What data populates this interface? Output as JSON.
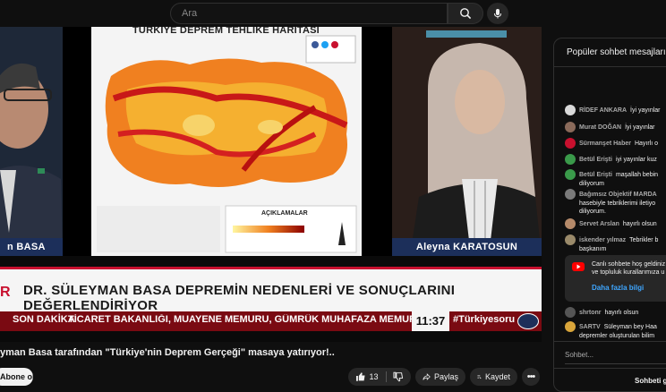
{
  "search": {
    "placeholder": "Ara"
  },
  "video": {
    "map_title": "TÜRKİYE DEPREM TEHLİKE HARİTASI",
    "legend_title": "AÇIKLAMALAR",
    "guest_name": "n BASA",
    "host_name": "Aleyna KARATOSUN",
    "headline": "DR. SÜLEYMAN BASA DEPREMİN NEDENLERİ VE SONUÇLARINI DEĞERLENDİRİYOR",
    "breaking_label": "SON DAKİKA",
    "ticker_text": "TİCARET BAKANLIĞI, MUAYENE MEMURU, GÜMRÜK MUHAFAZA MEMURU İLE KORUMA V",
    "clock": "11:37",
    "hashtag": "#Türkiyesoru"
  },
  "title": "yman Basa tarafından \"Türkiye'nin Deprem Gerçeği\" masaya yatırıyor!..",
  "actions": {
    "subscribe": "Abone ol",
    "likes": "13",
    "share": "Paylaş",
    "save": "Kaydet"
  },
  "chat": {
    "header": "Popüler sohbet mesajları",
    "messages": [
      {
        "author": "RİDEF ANKARA",
        "lines": [
          "İyi yayınlar"
        ],
        "avatar_color": "#d9d9d9"
      },
      {
        "author": "Murat DOĞAN",
        "lines": [
          "İyi yayınlar"
        ],
        "avatar_color": "#8a6a5a"
      },
      {
        "author": "Sürmanşet Haber",
        "lines": [
          "Hayırlı o"
        ],
        "avatar_color": "#c8102e"
      },
      {
        "author": "Betül Erişti",
        "lines": [
          "iyi yayınlar kuz"
        ],
        "avatar_color": "#3a9a4a"
      },
      {
        "author": "Betül Erişti",
        "lines": [
          "maşallah bebin",
          "diliyorum"
        ],
        "avatar_color": "#3a9a4a"
      },
      {
        "author": "Bağımsız Objektif MARDA",
        "lines": [
          "hasebiyle tebriklerimi iletiyo",
          "diliyorum."
        ],
        "avatar_color": "#7a7a7a"
      },
      {
        "author": "Servet Arslan",
        "lines": [
          "hayırlı olsun"
        ],
        "avatar_color": "#b58a6a"
      },
      {
        "author": "iskender yılmaz",
        "lines": [
          "Tebrikler b",
          "başkanım"
        ],
        "avatar_color": "#9a8a6a"
      }
    ],
    "welcome": {
      "lines": [
        "Canlı sohbete hoş geldiniz",
        "ve topluluk kurallarımıza u"
      ],
      "more": "Daha fazla bilgi"
    },
    "messages_bottom": [
      {
        "author": "shrtonr",
        "lines": [
          "hayırlı olsun"
        ],
        "avatar_color": "#555555"
      },
      {
        "author": "SARTV",
        "lines": [
          "Süleyman bey Haa",
          "depremler oluşturulan bilim"
        ],
        "avatar_color": "#d9a53a"
      }
    ],
    "input_placeholder": "Sohbet...",
    "footer": "Sohbeti gizle"
  },
  "colors": {
    "accent_red": "#c8102e",
    "ticker_red": "#7a0a12",
    "link_blue": "#3ea6ff"
  }
}
